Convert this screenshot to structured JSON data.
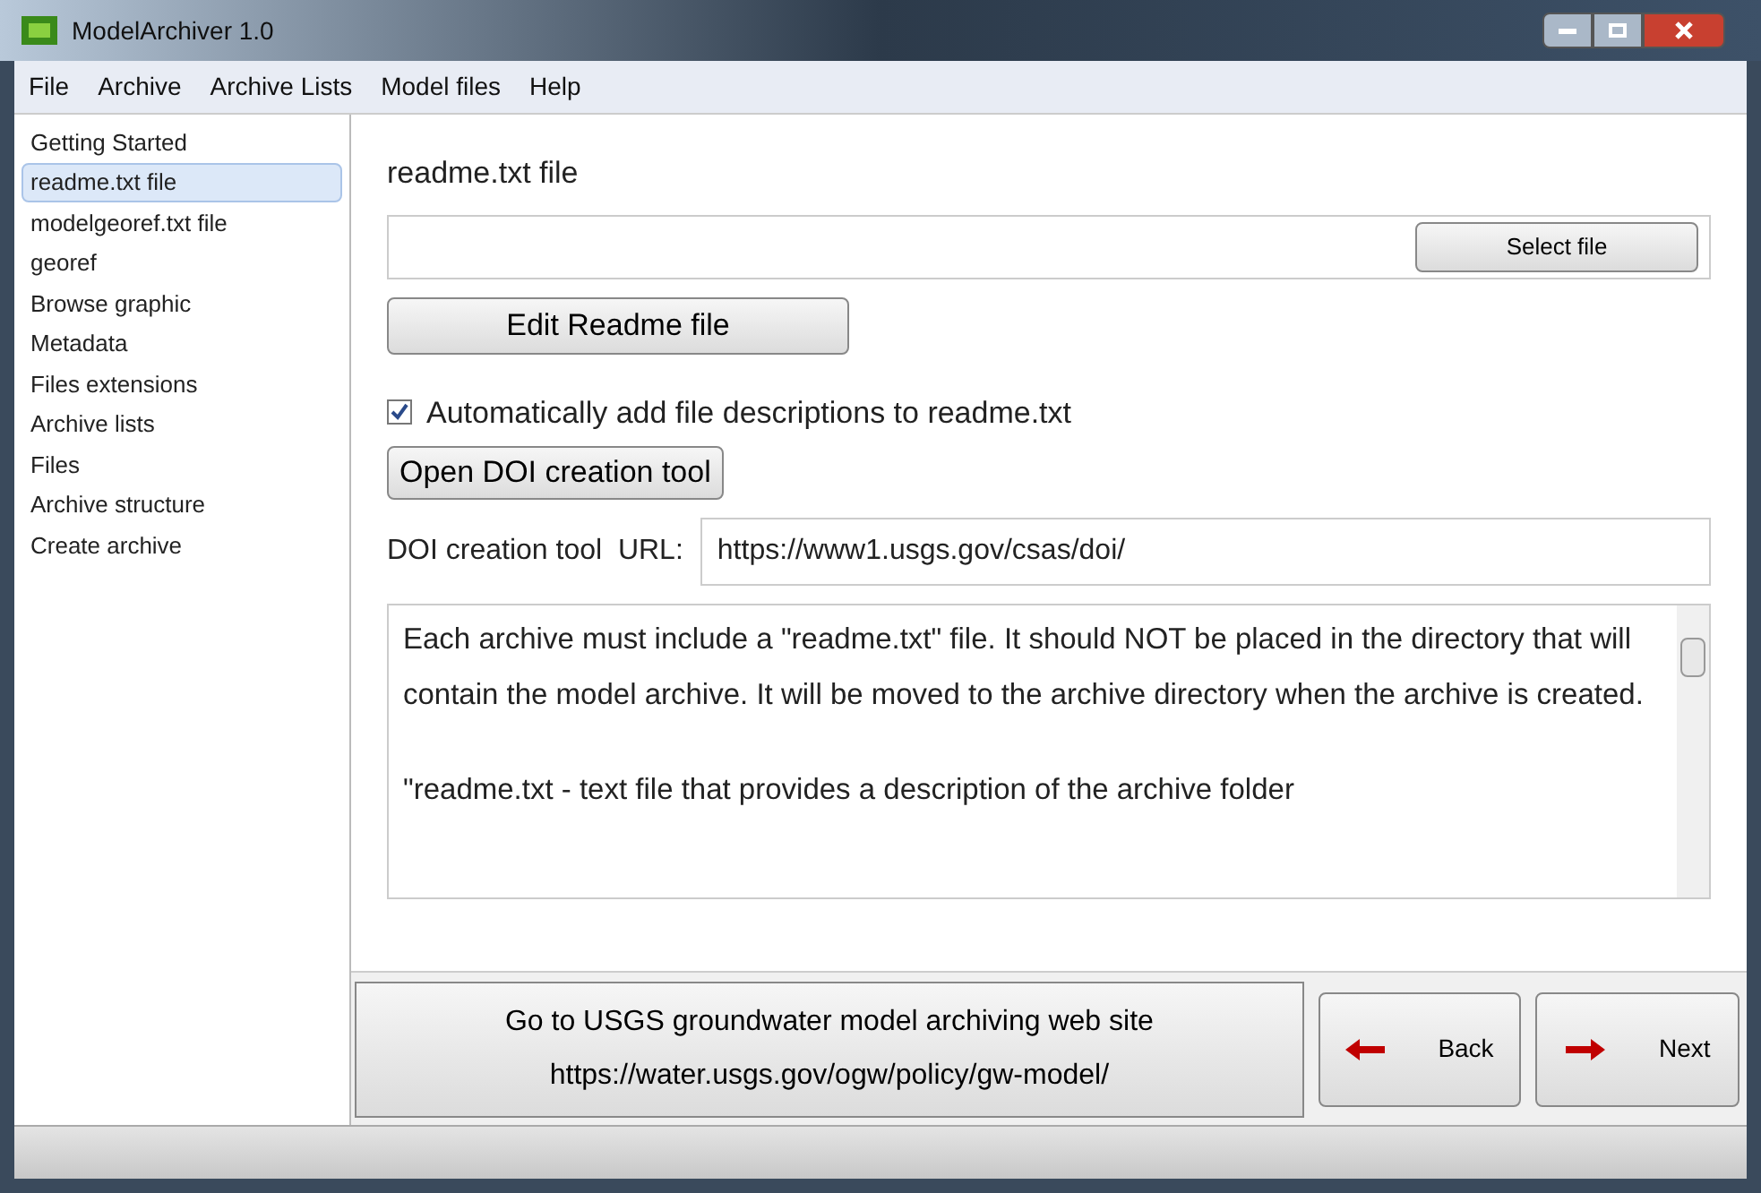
{
  "window": {
    "title": "ModelArchiver 1.0"
  },
  "menu": [
    "File",
    "Archive",
    "Archive Lists",
    "Model files",
    "Help"
  ],
  "sidebar": {
    "items": [
      {
        "label": "Getting Started",
        "selected": false
      },
      {
        "label": "readme.txt file",
        "selected": true
      },
      {
        "label": "modelgeoref.txt file",
        "selected": false
      },
      {
        "label": "georef",
        "selected": false
      },
      {
        "label": "Browse graphic",
        "selected": false
      },
      {
        "label": "Metadata",
        "selected": false
      },
      {
        "label": "Files extensions",
        "selected": false
      },
      {
        "label": "Archive lists",
        "selected": false
      },
      {
        "label": "Files",
        "selected": false
      },
      {
        "label": "Archive structure",
        "selected": false
      },
      {
        "label": "Create archive",
        "selected": false
      }
    ]
  },
  "main": {
    "heading": "readme.txt file",
    "select_button": "Select file",
    "edit_button": "Edit Readme file",
    "auto_add": {
      "label": "Automatically add file descriptions to readme.txt",
      "checked": true
    },
    "doi_button": "Open DOI creation tool",
    "doi_url": {
      "label": "DOI creation tool  URL:",
      "value": "https://www1.usgs.gov/csas/doi/"
    },
    "description": [
      "Each archive must include a \"readme.txt\" file. It should NOT be placed in the directory that will contain the model archive. It will be moved to the archive directory when the archive is created.",
      "\"readme.txt - text file that provides a description of the archive folder"
    ]
  },
  "footer": {
    "website_button": [
      "Go to USGS groundwater model archiving web site",
      "https://water.usgs.gov/ogw/policy/gw-model/"
    ],
    "back": "Back",
    "next": "Next"
  }
}
